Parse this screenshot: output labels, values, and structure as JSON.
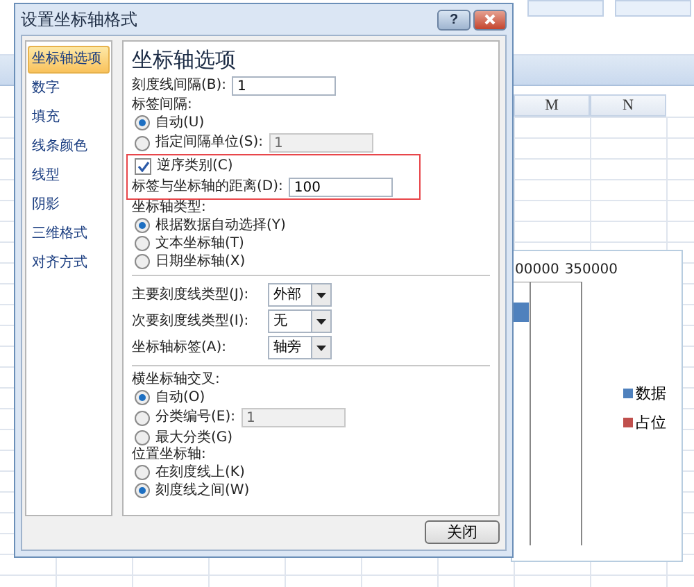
{
  "window": {
    "title": "设置坐标轴格式",
    "help_button": "?"
  },
  "sidebar": {
    "items": [
      {
        "label": "坐标轴选项",
        "selected": true
      },
      {
        "label": "数字",
        "selected": false
      },
      {
        "label": "填充",
        "selected": false
      },
      {
        "label": "线条颜色",
        "selected": false
      },
      {
        "label": "线型",
        "selected": false
      },
      {
        "label": "阴影",
        "selected": false
      },
      {
        "label": "三维格式",
        "selected": false
      },
      {
        "label": "对齐方式",
        "selected": false
      }
    ]
  },
  "panel": {
    "heading": "坐标轴选项",
    "items": [
      {
        "kind": "input",
        "label": "刻度线间隔(B):",
        "value": "1",
        "disabled": false
      },
      {
        "kind": "label",
        "text": "标签间隔:"
      },
      {
        "kind": "radio",
        "label": "自动(U)",
        "selected": true
      },
      {
        "kind": "radio",
        "label": "指定间隔单位(S):",
        "selected": false,
        "input": {
          "value": "1",
          "disabled": true
        }
      },
      {
        "kind": "group",
        "highlighted": true,
        "items": [
          {
            "kind": "checkbox",
            "label": "逆序类别(C)",
            "checked": true
          },
          {
            "kind": "input",
            "label": "标签与坐标轴的距离(D):",
            "value": "100",
            "disabled": false
          }
        ]
      },
      {
        "kind": "label",
        "text": "坐标轴类型:"
      },
      {
        "kind": "radio",
        "label": "根据数据自动选择(Y)",
        "selected": true
      },
      {
        "kind": "radio",
        "label": "文本坐标轴(T)",
        "selected": false
      },
      {
        "kind": "radio",
        "label": "日期坐标轴(X)",
        "selected": false
      },
      {
        "kind": "divider"
      },
      {
        "kind": "select",
        "label": "主要刻度线类型(J):",
        "value": "外部"
      },
      {
        "kind": "select",
        "label": "次要刻度线类型(I):",
        "value": "无"
      },
      {
        "kind": "select",
        "label": "坐标轴标签(A):",
        "value": "轴旁"
      },
      {
        "kind": "divider"
      },
      {
        "kind": "label",
        "text": "横坐标轴交叉:"
      },
      {
        "kind": "radio",
        "label": "自动(O)",
        "selected": true
      },
      {
        "kind": "radio",
        "label": "分类编号(E):",
        "selected": false,
        "input": {
          "value": "1",
          "disabled": true
        }
      },
      {
        "kind": "radio",
        "label": "最大分类(G)",
        "selected": false
      },
      {
        "kind": "label",
        "text": "位置坐标轴:"
      },
      {
        "kind": "radio",
        "label": "在刻度线上(K)",
        "selected": false
      },
      {
        "kind": "radio",
        "label": "刻度线之间(W)",
        "selected": true
      }
    ]
  },
  "close_button": "关闭",
  "sheet": {
    "column_headers": [
      "M",
      "N"
    ],
    "chart": {
      "axis_labels": [
        "00000",
        "350000"
      ],
      "legend": [
        {
          "label": "数据",
          "color": "#4f81bd"
        },
        {
          "label": "占位",
          "color": "#c0504d"
        }
      ]
    }
  }
}
